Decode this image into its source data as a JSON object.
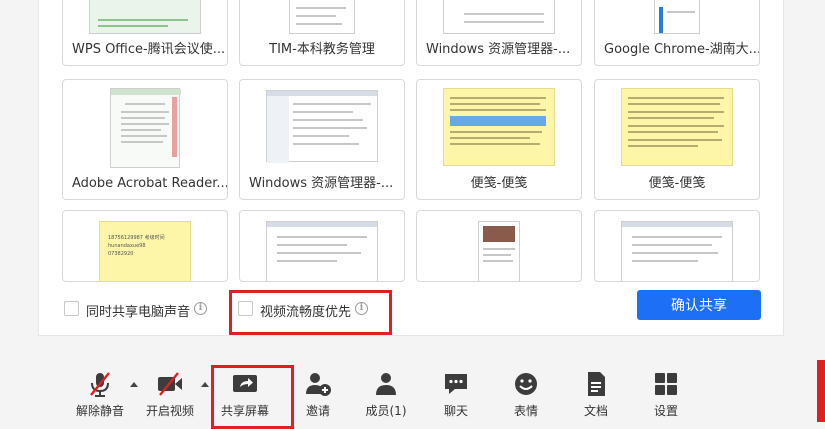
{
  "windows": [
    {
      "label": "WPS Office-腾讯会议使..."
    },
    {
      "label": "TIM-本科教务管理"
    },
    {
      "label": "Windows 资源管理器-..."
    },
    {
      "label": "Google Chrome-湖南大..."
    },
    {
      "label": "Adobe Acrobat Reader..."
    },
    {
      "label": "Windows 资源管理器-..."
    },
    {
      "label": "便笺-便笺"
    },
    {
      "label": "便笺-便笺"
    },
    {
      "label": ""
    },
    {
      "label": ""
    },
    {
      "label": ""
    },
    {
      "label": ""
    }
  ],
  "sticky_note": {
    "lines": [
      "18756129987 考级时间",
      "hunandaxue98",
      "07382920"
    ]
  },
  "options": {
    "share_audio": "同时共享电脑声音",
    "video_smooth": "视频流畅度优先",
    "info_glyph": "i"
  },
  "confirm_label": "确认共享",
  "toolbar": {
    "unmute": "解除静音",
    "start_video": "开启视频",
    "share_screen": "共享屏幕",
    "invite": "邀请",
    "members": "成员(1)",
    "chat": "聊天",
    "emoji": "表情",
    "docs": "文档",
    "settings": "设置"
  },
  "colors": {
    "accent": "#1d70f5",
    "highlight": "#e02020",
    "icon": "#3c3c3c",
    "sticky": "#fdf6a8"
  }
}
